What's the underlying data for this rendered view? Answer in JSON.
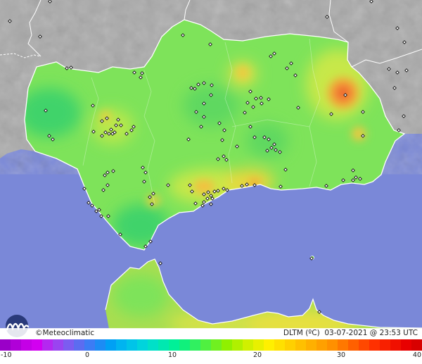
{
  "brand": {
    "name": "Meteoclimatic",
    "copyright": "©"
  },
  "caption": {
    "variable": "DLTM (ºC)",
    "date": "03-07-2021",
    "at": "@",
    "time": "23:53 UTC"
  },
  "legend": {
    "ticks": [
      "-10",
      "0",
      "10",
      "20",
      "30",
      "40"
    ],
    "colors": [
      "#9a00c8",
      "#b000d8",
      "#c400e6",
      "#d200f0",
      "#b428f0",
      "#9a44f0",
      "#7c5cf0",
      "#5c6cf0",
      "#3c7cf4",
      "#1c8cf4",
      "#00a0f4",
      "#00b4f0",
      "#00c4e8",
      "#00d4dc",
      "#00e0c8",
      "#00e8b0",
      "#00f098",
      "#10f07c",
      "#30f060",
      "#50f040",
      "#70f020",
      "#90f000",
      "#b0f000",
      "#d0f000",
      "#e8f000",
      "#fff000",
      "#ffe000",
      "#ffd000",
      "#ffc000",
      "#ffb000",
      "#ffa000",
      "#ff9000",
      "#ff7800",
      "#ff6000",
      "#ff4800",
      "#ff3000",
      "#f82000",
      "#f01000",
      "#e80000",
      "#d80000"
    ]
  },
  "map": {
    "region": "Andalucía",
    "colors": {
      "sea": "#7a88d8",
      "land_outside": "#a8a8a8",
      "base_temp": "#7ee35a",
      "warm_temp": "#c8e84a",
      "hot_temp": "#f4a838",
      "hottest": "#ee6a30",
      "cool_temp": "#3fd36a"
    }
  }
}
